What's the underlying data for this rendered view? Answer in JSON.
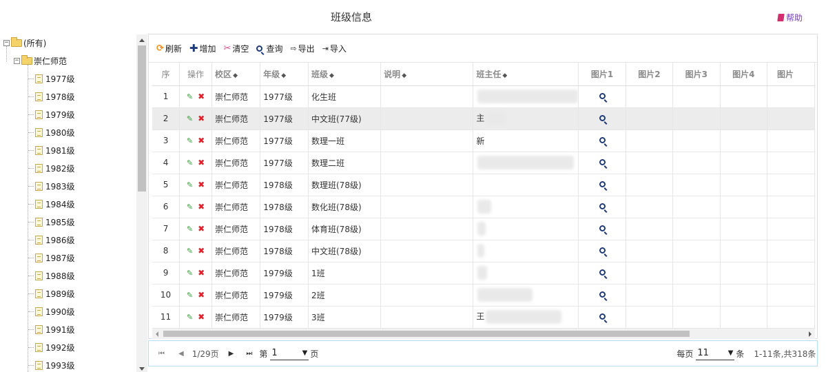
{
  "page": {
    "title": "班级信息",
    "help_label": "帮助"
  },
  "tree": {
    "root_label": "(所有)",
    "school_label": "崇仁师范",
    "years": [
      "1977级",
      "1978级",
      "1979级",
      "1980级",
      "1981级",
      "1982级",
      "1983级",
      "1984级",
      "1985级",
      "1986级",
      "1987级",
      "1988级",
      "1989级",
      "1990级",
      "1991级",
      "1992级",
      "1993级"
    ]
  },
  "toolbar": {
    "refresh": "刷新",
    "add": "增加",
    "clear": "清空",
    "query": "查询",
    "export": "导出",
    "import": "导入"
  },
  "table": {
    "headers": {
      "seq": "序",
      "ops": "操作",
      "campus": "校区",
      "grade": "年级",
      "class": "班级",
      "desc": "说明",
      "teacher": "班主任",
      "pic1": "图片1",
      "pic2": "图片2",
      "pic3": "图片3",
      "pic4": "图片4",
      "pic5": "图片"
    },
    "rows": [
      {
        "seq": "1",
        "campus": "崇仁师范",
        "grade": "1977级",
        "class": "化生班",
        "teacher": ""
      },
      {
        "seq": "2",
        "campus": "崇仁师范",
        "grade": "1977级",
        "class": "中文班(77级)",
        "teacher": "主"
      },
      {
        "seq": "3",
        "campus": "崇仁师范",
        "grade": "1977级",
        "class": "数理一班",
        "teacher": "新"
      },
      {
        "seq": "4",
        "campus": "崇仁师范",
        "grade": "1977级",
        "class": "数理二班",
        "teacher": ""
      },
      {
        "seq": "5",
        "campus": "崇仁师范",
        "grade": "1978级",
        "class": "数理班(78级)",
        "teacher": ""
      },
      {
        "seq": "6",
        "campus": "崇仁师范",
        "grade": "1978级",
        "class": "数化班(78级)",
        "teacher": ""
      },
      {
        "seq": "7",
        "campus": "崇仁师范",
        "grade": "1978级",
        "class": "体育班(78级)",
        "teacher": ""
      },
      {
        "seq": "8",
        "campus": "崇仁师范",
        "grade": "1978级",
        "class": "中文班(78级)",
        "teacher": ""
      },
      {
        "seq": "9",
        "campus": "崇仁师范",
        "grade": "1979级",
        "class": "1班",
        "teacher": ""
      },
      {
        "seq": "10",
        "campus": "崇仁师范",
        "grade": "1979级",
        "class": "2班",
        "teacher": ""
      },
      {
        "seq": "11",
        "campus": "崇仁师范",
        "grade": "1979级",
        "class": "3班",
        "teacher": "王"
      }
    ],
    "selected_row": 2
  },
  "pager": {
    "page_info": "1/29页",
    "goto_prefix": "第",
    "current_page": "1",
    "goto_suffix": "页",
    "per_page_prefix": "每页",
    "per_page": "11",
    "per_page_suffix": "条",
    "summary": "1-11条,共318条"
  },
  "colors": {
    "accent": "#1d3a78",
    "help": "#7a3fb3",
    "delete": "#e0202b",
    "edit": "#3a9a3a"
  }
}
